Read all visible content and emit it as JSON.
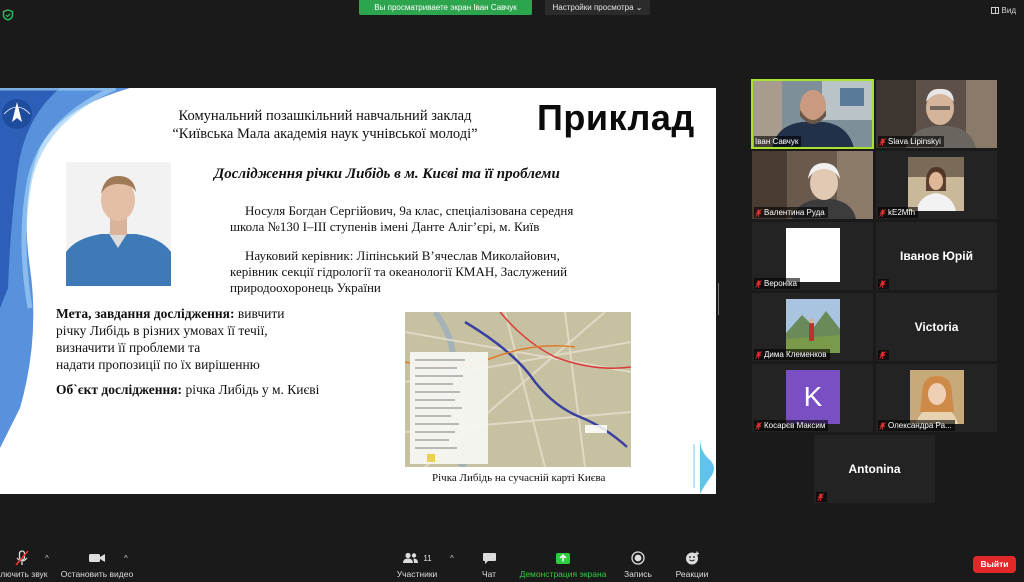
{
  "top_bar": {
    "share_banner": "Вы просматриваете экран Іван Савчук",
    "view_options": "Настройки просмотра",
    "view_button": "Вид",
    "accent_green": "#2da44e"
  },
  "slide": {
    "institution_line1": "Комунальний позашкільний навчальний заклад",
    "institution_line2": "“Київська Мала академія наук учнівської молоді”",
    "example_title": "Приклад",
    "research_title": "Дослідження річки Либідь в м. Києві та її проблеми",
    "author_line1": "Носуля Богдан Сергійович, 9а клас, спеціалізована середня",
    "author_line2": "школа №130 І–ІІІ ступенів імені Данте Аліг’єрі, м. Київ",
    "supervisor_line1": "Науковий керівник: Ліпінський В’ячеслав Миколайович,",
    "supervisor_line2": "керівник секції гідрології та океанології КМАН, Заслужений",
    "supervisor_line3": "природоохоронець України",
    "goal_label": "Мета, завдання дослідження:",
    "goal_text1": " вивчити",
    "goal_text2": "річку Либідь в різних умовах її течії,",
    "goal_text3": "визначити її проблеми та",
    "goal_text4": "надати пропозиції по їх вирішенню",
    "object_label": "Об`єкт дослідження:",
    "object_text": " річка Либідь у м. Києві",
    "map_caption": "Річка Либідь на сучасній карті Києва"
  },
  "participants": [
    {
      "name": "Іван Савчук",
      "type": "video",
      "active": true
    },
    {
      "name": "Slava Lipinskyi",
      "type": "video"
    },
    {
      "name": "Валентина Руда",
      "type": "video"
    },
    {
      "name": "kE2Mfh",
      "type": "video"
    },
    {
      "name": "Вероніка",
      "type": "video"
    },
    {
      "name": "Іванов Юрій",
      "type": "name-only"
    },
    {
      "name": "Дима Клеменков",
      "type": "video"
    },
    {
      "name": "Victoria",
      "type": "name-only"
    },
    {
      "name": "Косарєв Максим",
      "type": "avatar",
      "initial": "K",
      "avatar_color": "#7b4fc4"
    },
    {
      "name": "Олександра Ра...",
      "type": "video"
    },
    {
      "name": "Antonina",
      "type": "name-only"
    }
  ],
  "toolbar": {
    "unmute": "ключить звук",
    "stop_video": "Остановить видео",
    "participants": "Участники",
    "participants_count": "11",
    "chat": "Чат",
    "share_screen": "Демонстрация экрана",
    "record": "Запись",
    "reactions": "Реакции",
    "leave": "Выйти",
    "leave_color": "#e02828",
    "share_color": "#2ecc40"
  }
}
